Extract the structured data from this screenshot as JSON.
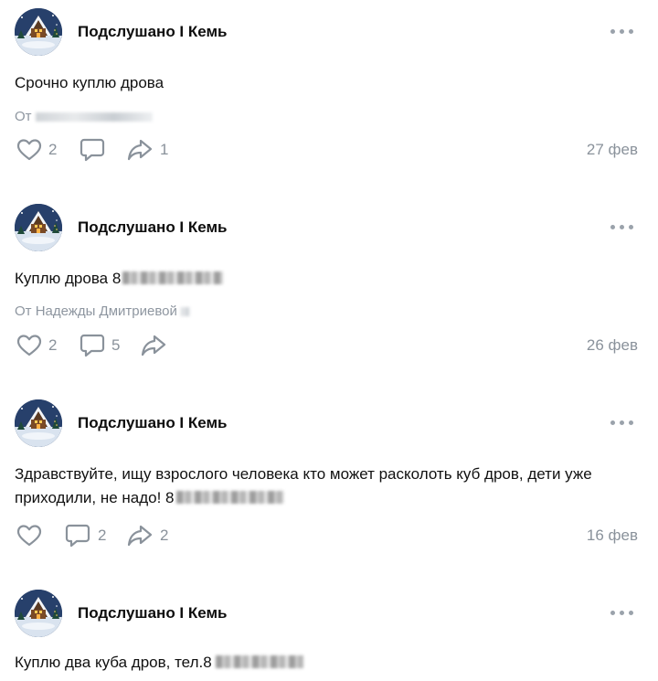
{
  "posts": [
    {
      "author": "Подслушано I Кемь",
      "text": "Срочно куплю дрова",
      "source_prefix": "От",
      "likes": "2",
      "comments": "",
      "reposts": "1",
      "date": "27 фев"
    },
    {
      "author": "Подслушано I Кемь",
      "text": "Куплю дрова 8",
      "source_prefix": "От Надежды Дмитриевой",
      "likes": "2",
      "comments": "5",
      "reposts": "",
      "date": "26 фев"
    },
    {
      "author": "Подслушано I Кемь",
      "text": "Здравствуйте, ищу взрослого человека кто может расколоть куб дров, дети уже приходили, не надо! 8",
      "source_prefix": "",
      "likes": "",
      "comments": "2",
      "reposts": "2",
      "date": "16 фев"
    },
    {
      "author": "Подслушано I Кемь",
      "text": "Куплю два куба дров, тел.8",
      "source_prefix": "",
      "likes": "",
      "comments": "",
      "reposts": "",
      "date": ""
    }
  ],
  "icons": {
    "like": "heart-outline-icon",
    "comment": "speech-bubble-icon",
    "repost": "share-arrow-icon",
    "more": "three-dots-icon"
  },
  "colors": {
    "icon": "#8a929b",
    "secondary_text": "#8e96a0",
    "avatar_bg": "#2a3f66"
  }
}
